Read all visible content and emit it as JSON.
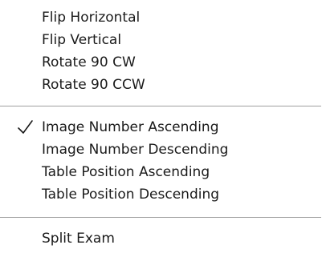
{
  "menu": {
    "items": [
      {
        "label": "Flip Horizontal",
        "checked": false
      },
      {
        "label": "Flip Vertical",
        "checked": false
      },
      {
        "label": "Rotate 90 CW",
        "checked": false
      },
      {
        "label": "Rotate 90 CCW",
        "checked": false
      },
      {
        "label": "Image Number Ascending",
        "checked": true
      },
      {
        "label": "Image Number Descending",
        "checked": false
      },
      {
        "label": "Table Position Ascending",
        "checked": false
      },
      {
        "label": "Table Position Descending",
        "checked": false
      },
      {
        "label": "Split Exam",
        "checked": false
      }
    ]
  },
  "colors": {
    "background": "#ffffff",
    "text": "#1a1a1a",
    "separator": "#a0a0a0"
  }
}
